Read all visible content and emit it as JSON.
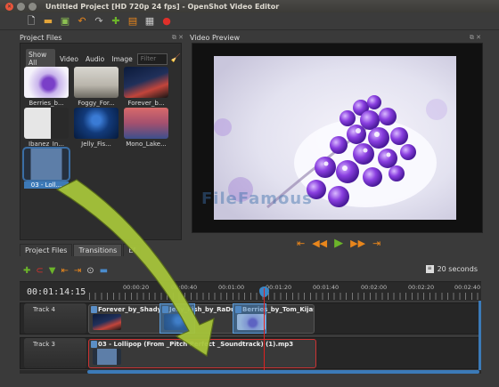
{
  "window": {
    "title": "Untitled Project [HD 720p 24 fps] - OpenShot Video Editor"
  },
  "toolbar": {
    "icons": [
      "new-project-icon",
      "open-project-icon",
      "save-project-icon",
      "undo-icon",
      "redo-icon",
      "import-files-icon",
      "profile-icon",
      "fullscreen-icon",
      "export-video-icon"
    ]
  },
  "project_files": {
    "header": "Project Files",
    "filters": [
      "Show All",
      "Video",
      "Audio",
      "Image"
    ],
    "filter_placeholder": "Filter",
    "files": [
      {
        "name": "Berries_b..."
      },
      {
        "name": "Foggy_For..."
      },
      {
        "name": "Forever_b..."
      },
      {
        "name": "Ibanez_In..."
      },
      {
        "name": "Jelly_Fis..."
      },
      {
        "name": "Mono_Lake..."
      },
      {
        "name": "03 - Loll..."
      }
    ]
  },
  "video_preview": {
    "header": "Video Preview",
    "watermark": "FileFamous"
  },
  "bottom_tabs": [
    "Project Files",
    "Transitions",
    "Ef"
  ],
  "timeline": {
    "zoom_label": "20 seconds",
    "timecode": "00:01:14:15",
    "ruler_labels": [
      "00:00:20",
      "00:00:40",
      "00:01:00",
      "00:01:20",
      "00:01:40",
      "00:02:00",
      "00:02:20",
      "00:02:40"
    ],
    "tracks": [
      {
        "name": "Track 4",
        "clips": [
          {
            "title": "Forever_by_Shady_S..."
          },
          {
            "title": "Jelly_Fish_by_RaDu_G..."
          },
          {
            "title": "Berries_by_Tom_Kijas.j..."
          }
        ]
      },
      {
        "name": "Track 3",
        "clips": [
          {
            "title": "03 - Lollipop (From _Pitch Perfect _Soundtrack) (1).mp3"
          }
        ]
      }
    ]
  }
}
